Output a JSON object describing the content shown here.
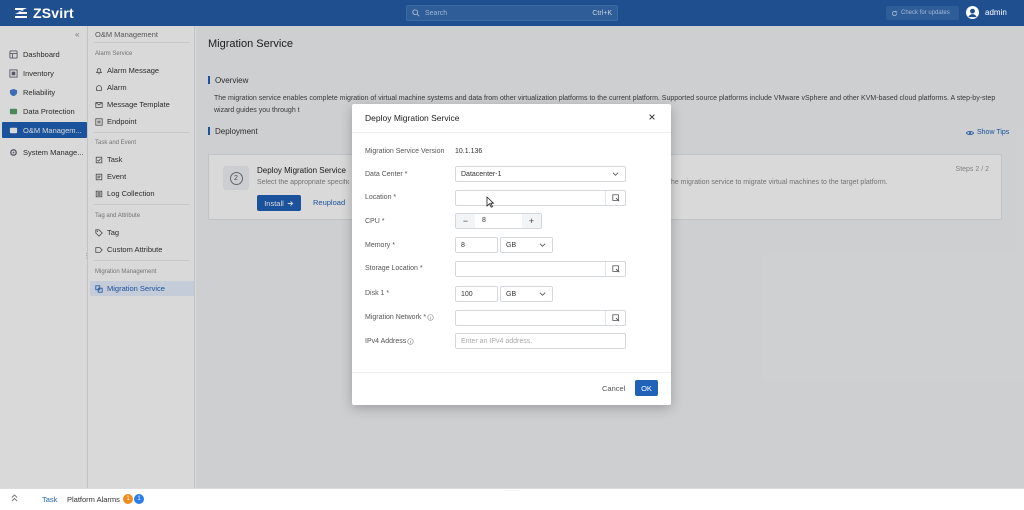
{
  "colors": {
    "topbar": "#1f4f8e",
    "accent": "#1f62b8",
    "badge_orange": "#f08c1e",
    "badge_blue": "#2b7de9"
  },
  "app": {
    "logo": "ZSvirt"
  },
  "topbar": {
    "search_placeholder": "Search",
    "search_shortcut": "Ctrl+K",
    "check_updates": "Check for updates",
    "user": "admin"
  },
  "sidebar": {
    "items": [
      {
        "label": "Dashboard",
        "icon": "dashboard-icon"
      },
      {
        "label": "Inventory",
        "icon": "inventory-icon"
      },
      {
        "label": "Reliability",
        "icon": "shield-icon"
      },
      {
        "label": "Data Protection",
        "icon": "data-protection-icon"
      },
      {
        "label": "O&M Managem...",
        "icon": "om-icon",
        "active": true
      },
      {
        "label": "System Manage...",
        "icon": "gear-icon"
      }
    ]
  },
  "subnav": {
    "title": "O&M Management",
    "sections": [
      {
        "title": "Alarm Service",
        "items": [
          {
            "label": "Alarm Message",
            "icon": "bell-icon"
          },
          {
            "label": "Alarm",
            "icon": "alarm-icon"
          },
          {
            "label": "Message Template",
            "icon": "template-icon"
          },
          {
            "label": "Endpoint",
            "icon": "endpoint-icon"
          }
        ]
      },
      {
        "title": "Task and Event",
        "items": [
          {
            "label": "Task",
            "icon": "task-icon"
          },
          {
            "label": "Event",
            "icon": "event-icon"
          },
          {
            "label": "Log Collection",
            "icon": "log-icon"
          }
        ]
      },
      {
        "title": "Tag and Attribute",
        "items": [
          {
            "label": "Tag",
            "icon": "tag-icon"
          },
          {
            "label": "Custom Attribute",
            "icon": "attribute-icon"
          }
        ]
      },
      {
        "title": "Migration Management",
        "items": [
          {
            "label": "Migration Service",
            "icon": "migration-icon",
            "active": true
          }
        ]
      }
    ]
  },
  "main": {
    "page_title": "Migration Service",
    "overview_title": "Overview",
    "overview_text": "The migration service enables complete migration of virtual machine systems and data from other virtualization platforms to the current platform. Supported source platforms include VMware vSphere and other KVM-based cloud platforms. A step-by-step wizard guides you through t",
    "deployment_title": "Deployment",
    "show_tips": "Show Tips",
    "card": {
      "step_number": "2",
      "title": "Deploy Migration Service",
      "subtitle": "Select the appropriate specifica",
      "subtitle_right": "the migration service to migrate virtual machines to the target platform.",
      "steps": "Steps 2 / 2",
      "install": "Install",
      "reupload": "Reupload"
    }
  },
  "bottombar": {
    "task": "Task",
    "platform_alarms": "Platform Alarms",
    "alarm_count_1": "1",
    "alarm_count_2": "1"
  },
  "modal": {
    "title": "Deploy Migration Service",
    "version_label": "Migration Service Version",
    "version_value": "10.1.136",
    "datacenter_label": "Data Center *",
    "datacenter_value": "Datacenter-1",
    "location_label": "Location *",
    "cpu_label": "CPU *",
    "cpu_value": "8",
    "memory_label": "Memory *",
    "memory_value": "8",
    "memory_unit": "GB",
    "storage_label": "Storage Location *",
    "disk_label": "Disk 1 *",
    "disk_value": "100",
    "disk_unit": "GB",
    "network_label": "Migration Network *",
    "ipv4_label": "IPv4 Address",
    "ipv4_placeholder": "Enter an IPv4 address.",
    "cancel": "Cancel",
    "ok": "OK"
  }
}
